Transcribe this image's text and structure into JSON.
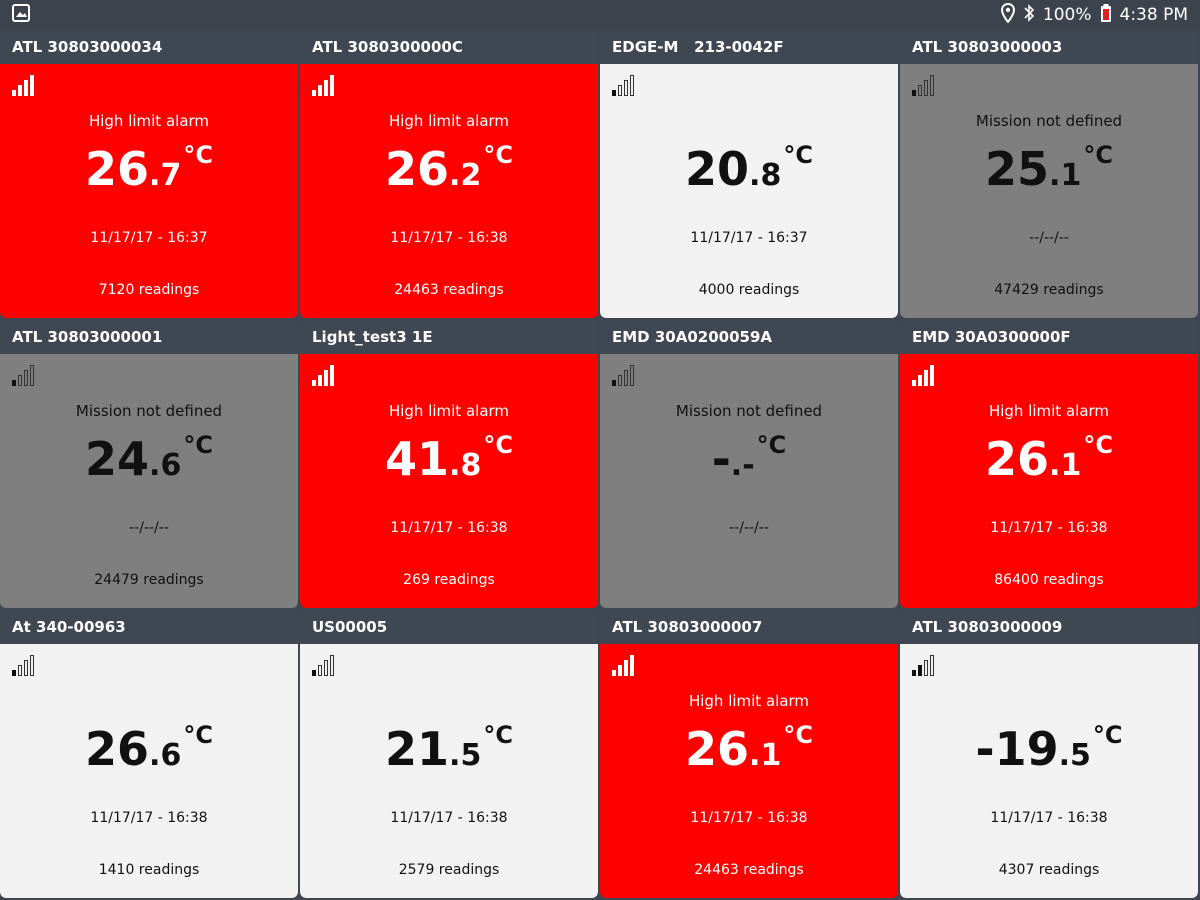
{
  "statusbar": {
    "battery_text": "100%",
    "time": "4:38 PM"
  },
  "colors": {
    "alarm": "#ff0000",
    "not_defined": "#7f7f7f",
    "normal": "#f2f2f2",
    "header": "#3f4752"
  },
  "sensors": [
    {
      "name": "ATL 30803000034",
      "state": "red",
      "status": "High limit alarm",
      "temp_int": "26",
      "temp_dec": ".7",
      "unit": "°C",
      "date": "11/17/17 - 16:37",
      "readings": "7120 readings",
      "signal_bars": 4
    },
    {
      "name": "ATL 3080300000C",
      "state": "red",
      "status": "High limit alarm",
      "temp_int": "26",
      "temp_dec": ".2",
      "unit": "°C",
      "date": "11/17/17 - 16:38",
      "readings": "24463 readings",
      "signal_bars": 4
    },
    {
      "name": "EDGE-M   213-0042F",
      "state": "light",
      "status": "",
      "temp_int": "20",
      "temp_dec": ".8",
      "unit": "°C",
      "date": "11/17/17 - 16:37",
      "readings": "4000 readings",
      "signal_bars": 1
    },
    {
      "name": "ATL 30803000003",
      "state": "gray",
      "status": "Mission not defined",
      "temp_int": "25",
      "temp_dec": ".1",
      "unit": "°C",
      "date": "--/--/--",
      "readings": "47429 readings",
      "signal_bars": 1
    },
    {
      "name": "ATL 30803000001",
      "state": "gray",
      "status": "Mission not defined",
      "temp_int": "24",
      "temp_dec": ".6",
      "unit": "°C",
      "date": "--/--/--",
      "readings": "24479 readings",
      "signal_bars": 1
    },
    {
      "name": "Light_test3 1E",
      "state": "red",
      "status": "High limit alarm",
      "temp_int": "41",
      "temp_dec": ".8",
      "unit": "°C",
      "date": "11/17/17 - 16:38",
      "readings": "269 readings",
      "signal_bars": 4
    },
    {
      "name": "EMD 30A0200059A",
      "state": "gray",
      "status": "Mission not defined",
      "temp_int": "-",
      "temp_dec": ".-",
      "unit": "°C",
      "date": "--/--/--",
      "readings": "",
      "signal_bars": 1
    },
    {
      "name": "EMD 30A0300000F",
      "state": "red",
      "status": "High limit alarm",
      "temp_int": "26",
      "temp_dec": ".1",
      "unit": "°C",
      "date": "11/17/17 - 16:38",
      "readings": "86400 readings",
      "signal_bars": 4
    },
    {
      "name": "At 340-00963",
      "state": "light",
      "status": "",
      "temp_int": "26",
      "temp_dec": ".6",
      "unit": "°C",
      "date": "11/17/17 - 16:38",
      "readings": "1410 readings",
      "signal_bars": 1
    },
    {
      "name": "US00005",
      "state": "light",
      "status": "",
      "temp_int": "21",
      "temp_dec": ".5",
      "unit": "°C",
      "date": "11/17/17 - 16:38",
      "readings": "2579 readings",
      "signal_bars": 1
    },
    {
      "name": "ATL 30803000007",
      "state": "red",
      "status": "High limit alarm",
      "temp_int": "26",
      "temp_dec": ".1",
      "unit": "°C",
      "date": "11/17/17 - 16:38",
      "readings": "24463 readings",
      "signal_bars": 4
    },
    {
      "name": "ATL 30803000009",
      "state": "light",
      "status": "",
      "temp_int": "-19",
      "temp_dec": ".5",
      "unit": "°C",
      "date": "11/17/17 - 16:38",
      "readings": "4307 readings",
      "signal_bars": 2
    }
  ]
}
